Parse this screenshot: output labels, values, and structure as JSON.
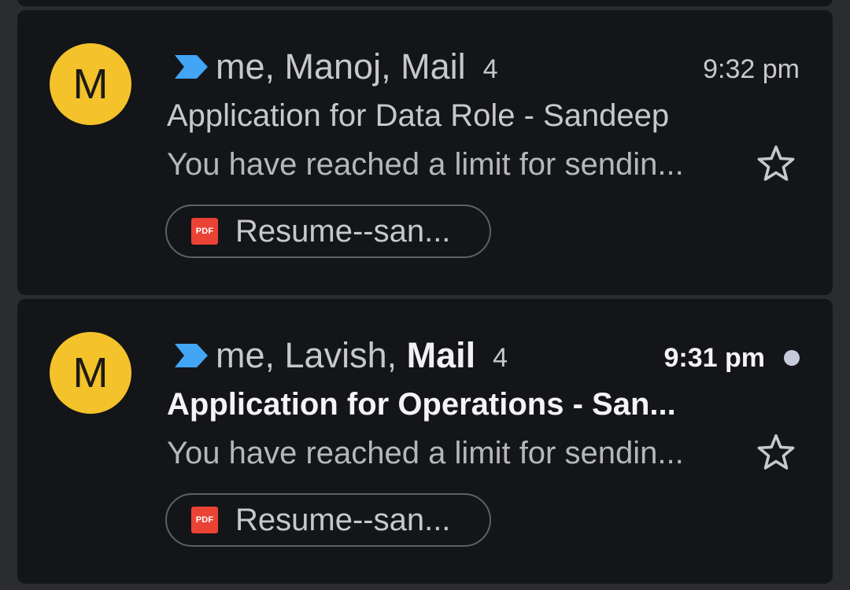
{
  "emails": [
    {
      "avatar_letter": "M",
      "senders_prefix": "me, Manoj, Mail",
      "senders_bold": "",
      "count": "4",
      "time": "9:32 pm",
      "unread": false,
      "subject": "Application for Data Role - Sandeep",
      "snippet": "You have reached a limit for sendin...",
      "attachment": {
        "type": "PDF",
        "name": "Resume--san..."
      }
    },
    {
      "avatar_letter": "M",
      "senders_prefix": "me, Lavish, ",
      "senders_bold": "Mail",
      "count": "4",
      "time": "9:31 pm",
      "unread": true,
      "subject": "Application for Operations - San...",
      "snippet": "You have reached a limit for sendin...",
      "attachment": {
        "type": "PDF",
        "name": "Resume--san..."
      }
    }
  ],
  "colors": {
    "background": "#2b2c2f",
    "card": "#141518",
    "avatar": "#f4c22b",
    "important_marker": "#42a5f5",
    "pdf": "#ea4335",
    "unread_dot": "#c6cbdc"
  },
  "icons": {
    "important": "important-marker-icon",
    "star": "star-outline-icon",
    "attachment": "pdf-file-icon"
  }
}
